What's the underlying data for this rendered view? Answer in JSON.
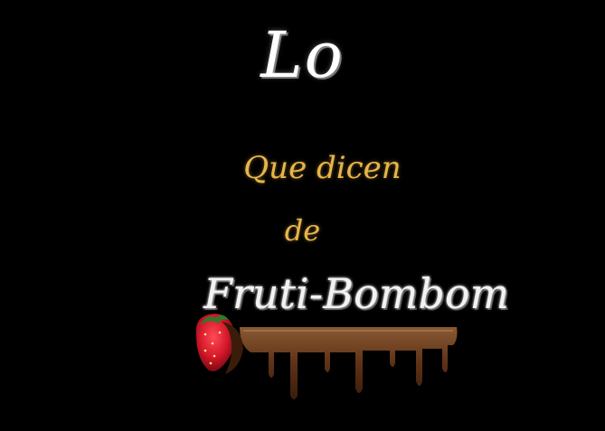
{
  "texts": {
    "lo": "Lo",
    "que_dicen": "Que dicen",
    "de": "de",
    "logo": "Fruti-Bombom"
  },
  "colors": {
    "background": "#000000",
    "title": "#ffffff",
    "accent_gold": "#e8b54a",
    "chocolate": "#6b3a1c",
    "strawberry": "#d4182a"
  },
  "decorations": [
    "strawberry-icon",
    "chocolate-drip"
  ]
}
